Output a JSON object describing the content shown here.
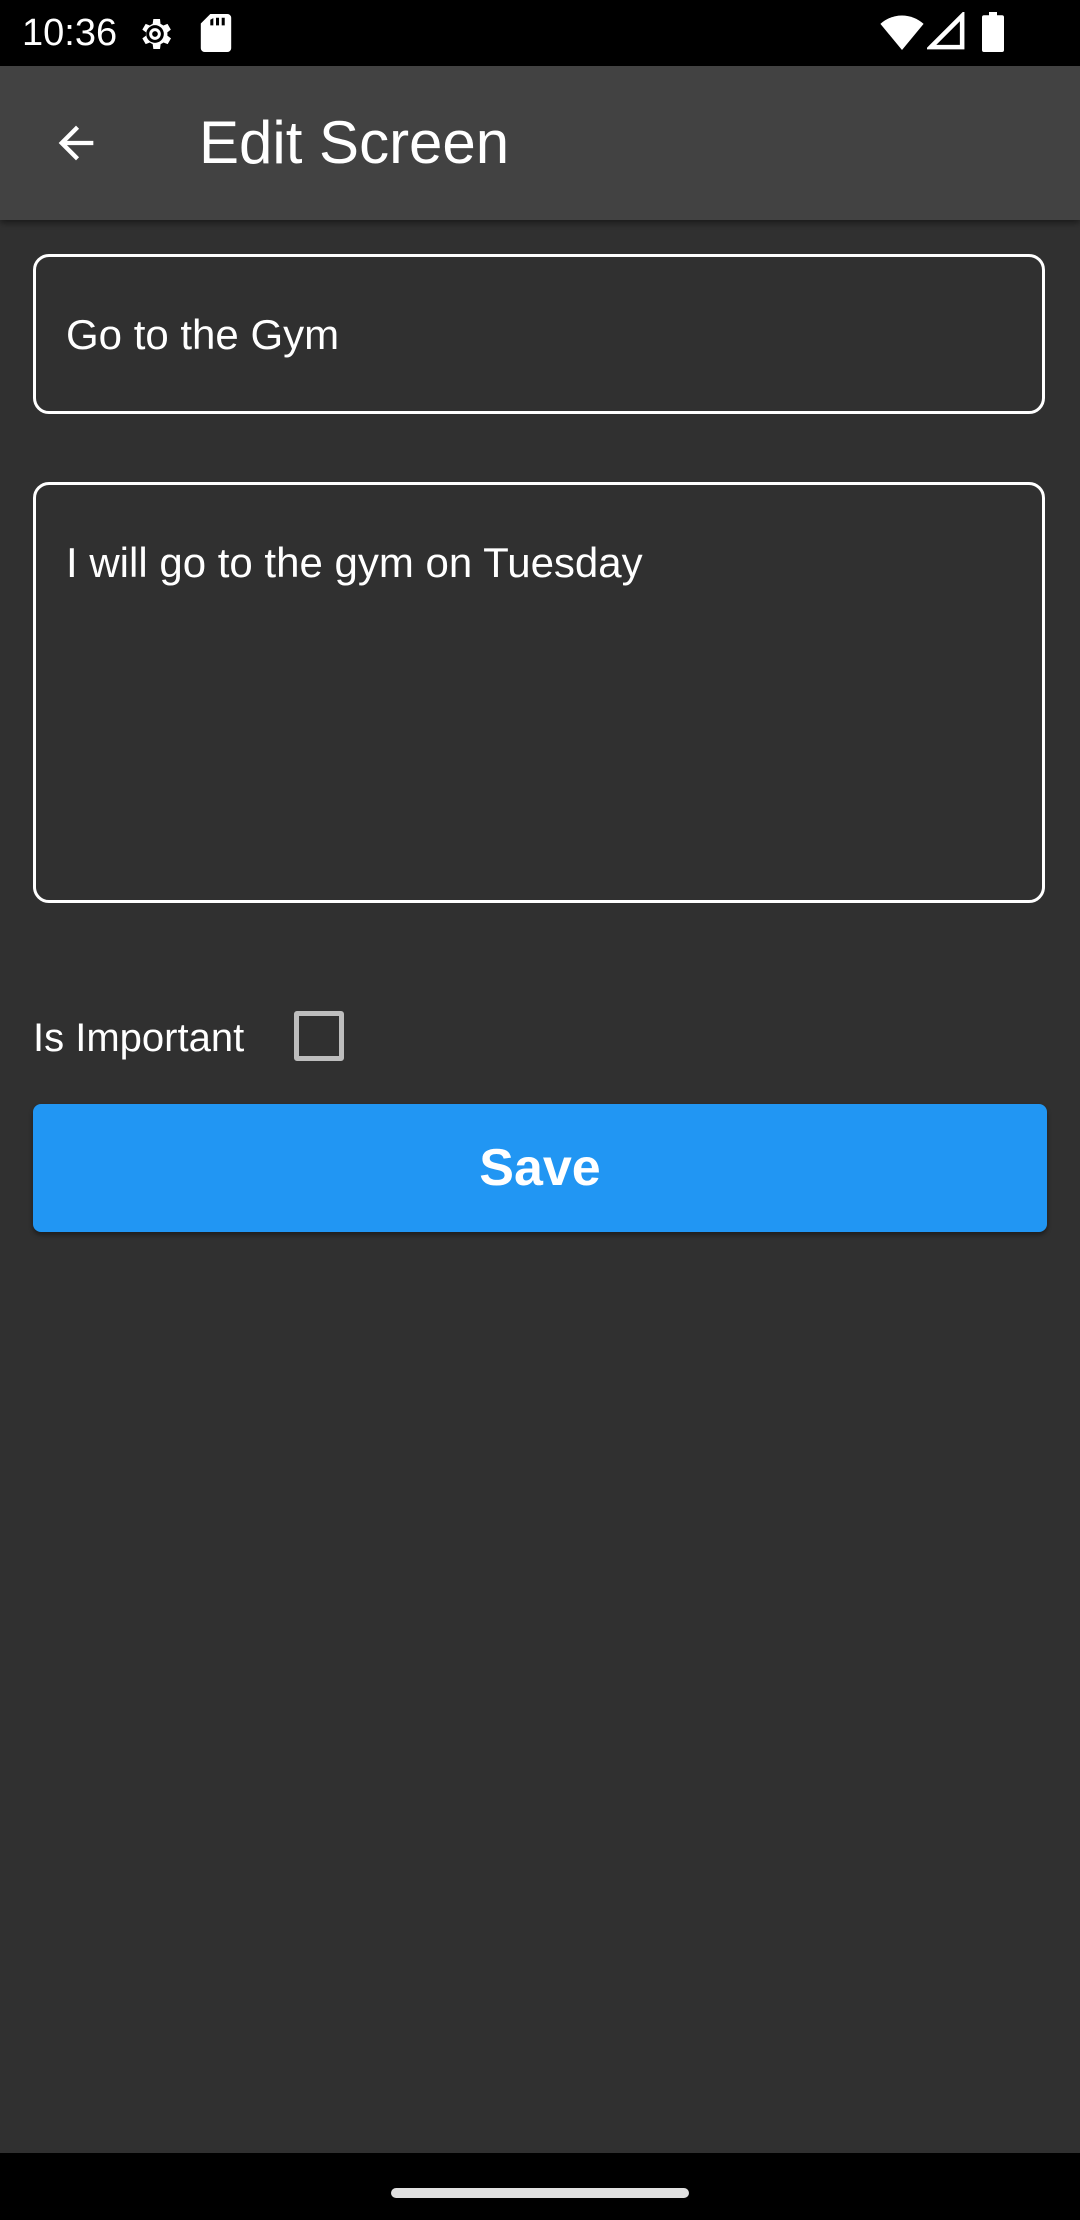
{
  "status_bar": {
    "time": "10:36",
    "icons": [
      "settings-icon",
      "sd-card-icon",
      "wifi-icon",
      "signal-icon",
      "battery-icon"
    ]
  },
  "app_bar": {
    "title": "Edit Screen",
    "back_icon": "arrow-back-icon"
  },
  "form": {
    "title_value": "Go to the Gym",
    "description_value": "I will go to the gym on Tuesday",
    "important_label": "Is Important",
    "important_checked": false,
    "save_label": "Save"
  },
  "colors": {
    "background": "#303030",
    "app_bar": "#424242",
    "accent": "#2196f3",
    "status_bar": "#000000"
  }
}
